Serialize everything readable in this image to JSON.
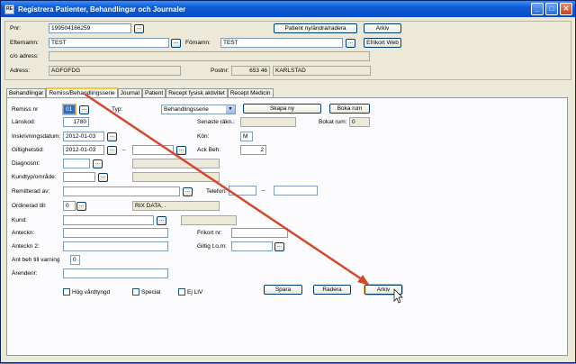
{
  "window": {
    "title": "Registrera Patienter, Behandlingar och Journaler",
    "icon_text": "RE"
  },
  "titlebar_controls": {
    "minimize": "_",
    "maximize": "□",
    "close": "✕"
  },
  "patient": {
    "pnr_label": "Pnr:",
    "pnr_value": "199504166259",
    "efternamn_label": "Efternamn:",
    "efternamn_value": "TEST",
    "fornamn_label": "Förnamn:",
    "fornamn_value": "TEST",
    "co_label": "c/o adress:",
    "co_value": "",
    "adress_label": "Adress:",
    "adress_value": "AGFGFDG",
    "postnr_label": "Postnr:",
    "postnr_value": "653 46",
    "ort_value": "KARLSTAD",
    "btn_patient": "Patient ny/ändra/radera",
    "btn_arkiv": "Arkiv",
    "btn_efrikort": "Efrikort Web"
  },
  "tabs": [
    "Behandlingar",
    "Remiss/Behandlingsserie",
    "Journal",
    "Patient",
    "Recept fysisk aktivitet",
    "Recept Medicin"
  ],
  "form": {
    "remiss_label": "Remiss nr",
    "remiss_value": "01",
    "typ_label": "Typ:",
    "typ_value": "Behandlingsserie",
    "btn_skapa": "Skapa ny",
    "btn_boka": "Boka rum",
    "lanskod_label": "Länskod:",
    "lanskod_value": "1780",
    "senaste_label": "Senaste räkn.:",
    "senaste_value": "",
    "bokat_label": "Bokat rum:",
    "bokat_value": "0",
    "inskr_label": "Inskrivningsdatum:",
    "inskr_value": "2012-01-03",
    "kon_label": "Kön:",
    "kon_value": "M",
    "giltig_label": "Giltighetstid:",
    "giltig_from": "2012-01-03",
    "giltig_dash": "–",
    "giltig_to": "",
    "ackbeh_label": "Ack Beh:",
    "ackbeh_value": "2",
    "diagnos_label": "Diagnosnr:",
    "diagnos_value": "",
    "diagnos_text": "",
    "kundtyp_label": "Kundtyp/område:",
    "kundtyp_value": "",
    "kundtyp_text": "",
    "remitterad_label": "Remitterad av:",
    "remitterad_value": "",
    "telefon_label": "Telefon:",
    "telefon_a": "",
    "telefon_dash": "–",
    "telefon_b": "",
    "ordinerad_label": "Ordinerad till:",
    "ordinerad_value": "0",
    "ordinerad_text": "RIX DATA, .",
    "kund_label": "Kund:",
    "kund_value": "",
    "kund_text": "",
    "anteckn_label": "Anteckn:",
    "anteckn_value": "",
    "frikort_label": "Frikort nr:",
    "frikort_value": "",
    "anteckn2_label": "Anteckn 2:",
    "anteckn2_value": "",
    "giltigtom_label": "Giltig t.o.m:",
    "giltigtom_value": "",
    "antbeh_label": "Ant beh till varning",
    "antbeh_value": "0",
    "arende_label": "Ärendenr:",
    "arende_value": "",
    "chk_hog": "Hög vårdtyngd",
    "chk_special": "Special",
    "chk_ejliv": "Ej LIV",
    "btn_spara": "Spara",
    "btn_radera": "Radera",
    "btn_arkiv": "Arkiv",
    "dots": "..."
  },
  "colors": {
    "arrow": "#d9472b",
    "title_bar": "#0b5ad8"
  }
}
